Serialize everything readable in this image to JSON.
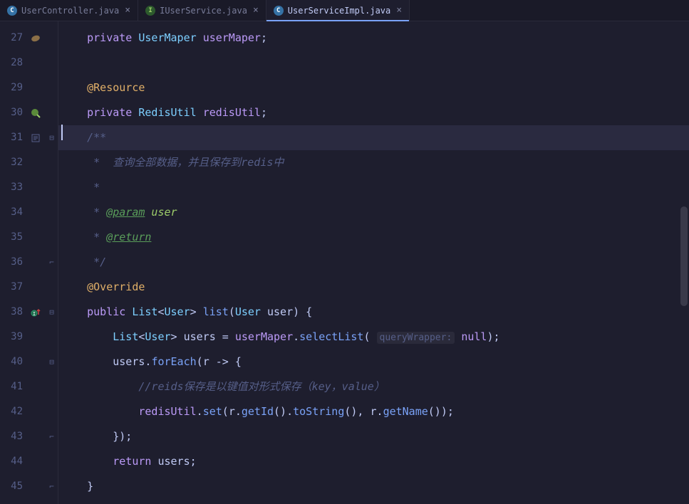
{
  "tabs": [
    {
      "label": "UserController.java",
      "icon": "C",
      "active": false
    },
    {
      "label": "IUserService.java",
      "icon": "I",
      "active": false
    },
    {
      "label": "UserServiceImpl.java",
      "icon": "C",
      "active": true
    }
  ],
  "lines": {
    "start": 27,
    "end": 45
  },
  "code": {
    "l27_kw": "private",
    "l27_type": "UserMaper",
    "l27_field": "userMaper",
    "l29_ann": "@Resource",
    "l30_kw": "private",
    "l30_type": "RedisUtil",
    "l30_field": "redisUtil",
    "l31_doc": "/**",
    "l32_doc": " *  查询全部数据，并且保存到redis中",
    "l33_doc": " *",
    "l34_star": " * ",
    "l34_tag": "@param",
    "l34_param": " user",
    "l35_star": " * ",
    "l35_tag": "@return",
    "l36_doc": " */",
    "l37_ann": "@Override",
    "l38_kw_public": "public",
    "l38_type": "List",
    "l38_gen": "User",
    "l38_method": "list",
    "l38_ptype": "User",
    "l38_pname": "user",
    "l39_type": "List",
    "l39_gen": "User",
    "l39_var": "users",
    "l39_eq": " = ",
    "l39_field": "userMaper",
    "l39_method": "selectList",
    "l39_hint": "queryWrapper:",
    "l39_null": "null",
    "l40_var": "users",
    "l40_method": "forEach",
    "l40_lambda": "r -> {",
    "l41_comment": "//reids保存是以键值对形式保存（key，value）",
    "l42_field": "redisUtil",
    "l42_method1": "set",
    "l42_r1": "r",
    "l42_getId": "getId",
    "l42_toString": "toString",
    "l42_r2": "r",
    "l42_getName": "getName",
    "l43_close": "});",
    "l44_kw": "return",
    "l44_var": "users",
    "l45_brace": "}"
  }
}
